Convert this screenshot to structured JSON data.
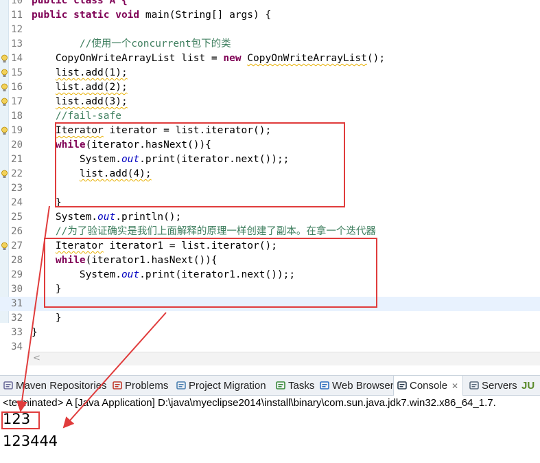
{
  "editor": {
    "lines": [
      {
        "num": "10",
        "segs": [
          {
            "t": "public class A {",
            "c": "kw"
          }
        ]
      },
      {
        "num": "11",
        "segs": [
          {
            "t": "public static void",
            "c": "kw"
          },
          {
            "t": " main(String[] args) {",
            "c": ""
          }
        ]
      },
      {
        "num": "12",
        "segs": []
      },
      {
        "num": "13",
        "segs": [
          {
            "t": "        //使用一个concurrent包下的类",
            "c": "cm"
          }
        ]
      },
      {
        "num": "14",
        "segs": [
          {
            "t": "    CopyOnWriteArrayList list = ",
            "c": ""
          },
          {
            "t": "new",
            "c": "kw"
          },
          {
            "t": " ",
            "c": ""
          },
          {
            "t": "CopyOnWriteArrayList",
            "c": "warn"
          },
          {
            "t": "();",
            "c": ""
          }
        ]
      },
      {
        "num": "15",
        "segs": [
          {
            "t": "    ",
            "c": ""
          },
          {
            "t": "list.add(1);",
            "c": "warn"
          }
        ]
      },
      {
        "num": "16",
        "segs": [
          {
            "t": "    ",
            "c": ""
          },
          {
            "t": "list.add(2);",
            "c": "warn"
          }
        ]
      },
      {
        "num": "17",
        "segs": [
          {
            "t": "    ",
            "c": ""
          },
          {
            "t": "list.add(3);",
            "c": "warn"
          }
        ]
      },
      {
        "num": "18",
        "segs": [
          {
            "t": "    //fail-safe",
            "c": "cm"
          }
        ]
      },
      {
        "num": "19",
        "segs": [
          {
            "t": "    ",
            "c": ""
          },
          {
            "t": "Iterator",
            "c": "warn"
          },
          {
            "t": " iterator = list.iterator();",
            "c": ""
          }
        ]
      },
      {
        "num": "20",
        "segs": [
          {
            "t": "    ",
            "c": ""
          },
          {
            "t": "while",
            "c": "kw"
          },
          {
            "t": "(iterator.hasNext()){",
            "c": ""
          }
        ]
      },
      {
        "num": "21",
        "segs": [
          {
            "t": "        System.",
            "c": ""
          },
          {
            "t": "out",
            "c": "fld"
          },
          {
            "t": ".print(iterator.next());;",
            "c": ""
          }
        ]
      },
      {
        "num": "22",
        "segs": [
          {
            "t": "        ",
            "c": ""
          },
          {
            "t": "list.add(4);",
            "c": "warn"
          }
        ]
      },
      {
        "num": "23",
        "segs": []
      },
      {
        "num": "24",
        "segs": [
          {
            "t": "    }",
            "c": ""
          }
        ]
      },
      {
        "num": "25",
        "segs": [
          {
            "t": "    System.",
            "c": ""
          },
          {
            "t": "out",
            "c": "fld"
          },
          {
            "t": ".println();",
            "c": ""
          }
        ]
      },
      {
        "num": "26",
        "segs": [
          {
            "t": "    //为了验证确实是我们上面解释的原理一样创建了副本。在拿一个迭代器",
            "c": "cm"
          }
        ]
      },
      {
        "num": "27",
        "segs": [
          {
            "t": "    ",
            "c": ""
          },
          {
            "t": "Iterator",
            "c": "warn"
          },
          {
            "t": " iterator1 = list.iterator();",
            "c": ""
          }
        ]
      },
      {
        "num": "28",
        "segs": [
          {
            "t": "    ",
            "c": ""
          },
          {
            "t": "while",
            "c": "kw"
          },
          {
            "t": "(iterator1.hasNext()){",
            "c": ""
          }
        ]
      },
      {
        "num": "29",
        "segs": [
          {
            "t": "        System.",
            "c": ""
          },
          {
            "t": "out",
            "c": "fld"
          },
          {
            "t": ".print(iterator1.next());;",
            "c": ""
          }
        ]
      },
      {
        "num": "30",
        "segs": [
          {
            "t": "    }",
            "c": ""
          }
        ]
      },
      {
        "num": "31",
        "segs": []
      },
      {
        "num": "32",
        "segs": [
          {
            "t": "    }",
            "c": ""
          }
        ]
      },
      {
        "num": "33",
        "segs": [
          {
            "t": "}",
            "c": ""
          }
        ]
      },
      {
        "num": "34",
        "segs": []
      }
    ],
    "warning_marker_lines": [
      "14",
      "15",
      "16",
      "17",
      "19",
      "22",
      "27"
    ],
    "current_line": "31",
    "hscroll_arrow": "<"
  },
  "views": {
    "tabs": [
      {
        "label": "Maven Repositories",
        "icon": "maven-icon"
      },
      {
        "label": "Problems",
        "icon": "problems-icon"
      },
      {
        "label": "Project Migration",
        "icon": "migration-icon"
      },
      {
        "label": "Tasks",
        "icon": "tasks-icon"
      },
      {
        "label": "Web Browser",
        "icon": "globe-icon"
      },
      {
        "label": "Console",
        "icon": "console-icon",
        "active": true
      },
      {
        "label": "Servers",
        "icon": "servers-icon"
      },
      {
        "label": "JU",
        "icon": "junit-icon"
      }
    ],
    "close_glyph": "✕"
  },
  "console": {
    "status": "<terminated> A [Java Application] D:\\java\\myeclipse2014\\install\\binary\\com.sun.java.jdk7.win32.x86_64_1.7.",
    "output": [
      "123",
      "123444"
    ]
  },
  "colors": {
    "annotation": "#e03c3c",
    "keyword": "#7f0055",
    "comment": "#3f7f5f",
    "field": "#0000c0"
  }
}
